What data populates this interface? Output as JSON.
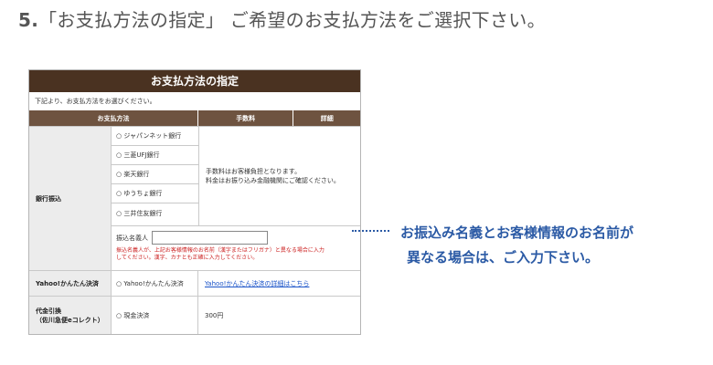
{
  "heading": {
    "number": "5.",
    "text": "「お支払方法の指定」 ご希望のお支払方法をご選択下さい。"
  },
  "panel": {
    "title": "お支払方法の指定",
    "intro": "下記より、お支払方法をお選びください。",
    "headers": [
      "お支払方法",
      "手数料",
      "詳細"
    ],
    "bank_transfer": {
      "label": "銀行振込",
      "banks": [
        "ジャパンネット銀行",
        "三菱UFJ銀行",
        "楽天銀行",
        "ゆうちょ銀行",
        "三井住友銀行"
      ],
      "fee_line1": "手数料はお客様負担となります。",
      "fee_line2": "料金はお振り込み金融機関にご確認ください。",
      "payer_label": "振込名義人",
      "payer_value": "",
      "warning_line1": "振込名義人が、上記お客様情報のお名前（漢字またはフリガナ）と異なる場合に入力",
      "warning_line2": "してください。漢字、カナとも正確に入力してください。"
    },
    "yahoo": {
      "label": "Yahoo!かんたん決済",
      "option": "Yahoo!かんたん決済",
      "link": "Yahoo!かんたん決済の詳細はこちら"
    },
    "cod": {
      "label_line1": "代金引換",
      "label_line2": "（佐川急便eコレクト）",
      "option": "現金決済",
      "fee": "300円"
    }
  },
  "callout": {
    "line1": "お振込み名義とお客様情報のお名前が",
    "line2": "異なる場合は、ご入力下さい。"
  },
  "colors": {
    "title_bar": "#4a3221",
    "header_bar": "#6e5340",
    "callout": "#2b5aa5",
    "warning": "#cc2222"
  }
}
